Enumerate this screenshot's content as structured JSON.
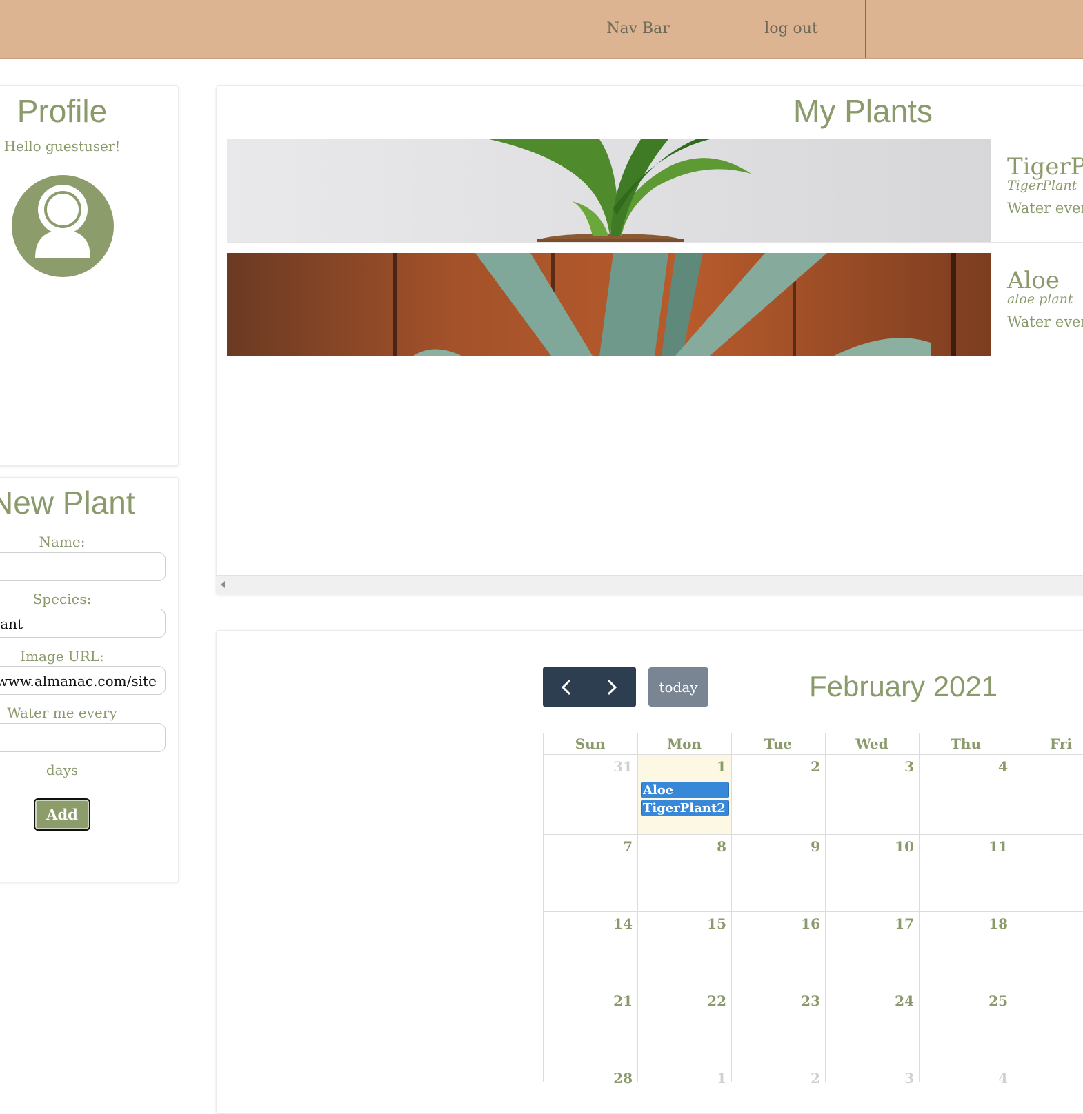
{
  "nav": {
    "title": "Nav Bar",
    "logout": "log out"
  },
  "profile": {
    "title": "Profile",
    "greeting": "Hello guestuser!"
  },
  "new_plant": {
    "title": "New Plant",
    "name_label": "Name:",
    "name_value": "",
    "species_label": "Species:",
    "species_value": "plant",
    "image_label": "Image URL:",
    "image_value": "//www.almanac.com/site",
    "water_label": "Water me every",
    "water_value": "",
    "days_label": "days",
    "add_label": "Add"
  },
  "my_plants": {
    "title": "My Plants",
    "plants": [
      {
        "name": "TigerPl",
        "species": "TigerPlant",
        "water": "Water every"
      },
      {
        "name": "Aloe",
        "species": "aloe plant",
        "water": "Water every"
      }
    ]
  },
  "calendar": {
    "today_label": "today",
    "title": "February 2021",
    "weekdays": [
      "Sun",
      "Mon",
      "Tue",
      "Wed",
      "Thu",
      "Fri"
    ],
    "weeks": [
      [
        "31",
        "1",
        "2",
        "3",
        "4"
      ],
      [
        "7",
        "8",
        "9",
        "10",
        "11"
      ],
      [
        "14",
        "15",
        "16",
        "17",
        "18"
      ],
      [
        "21",
        "22",
        "23",
        "24",
        "25"
      ],
      [
        "28",
        "1",
        "2",
        "3",
        "4"
      ]
    ],
    "events": [
      "Aloe",
      "TigerPlant2"
    ]
  },
  "colors": {
    "nav_bg": "#dcb492",
    "accent_green": "#8a9a6b",
    "calendar_nav": "#2c3e50",
    "event_blue": "#3788d8",
    "today_highlight": "#fcf8e3"
  }
}
